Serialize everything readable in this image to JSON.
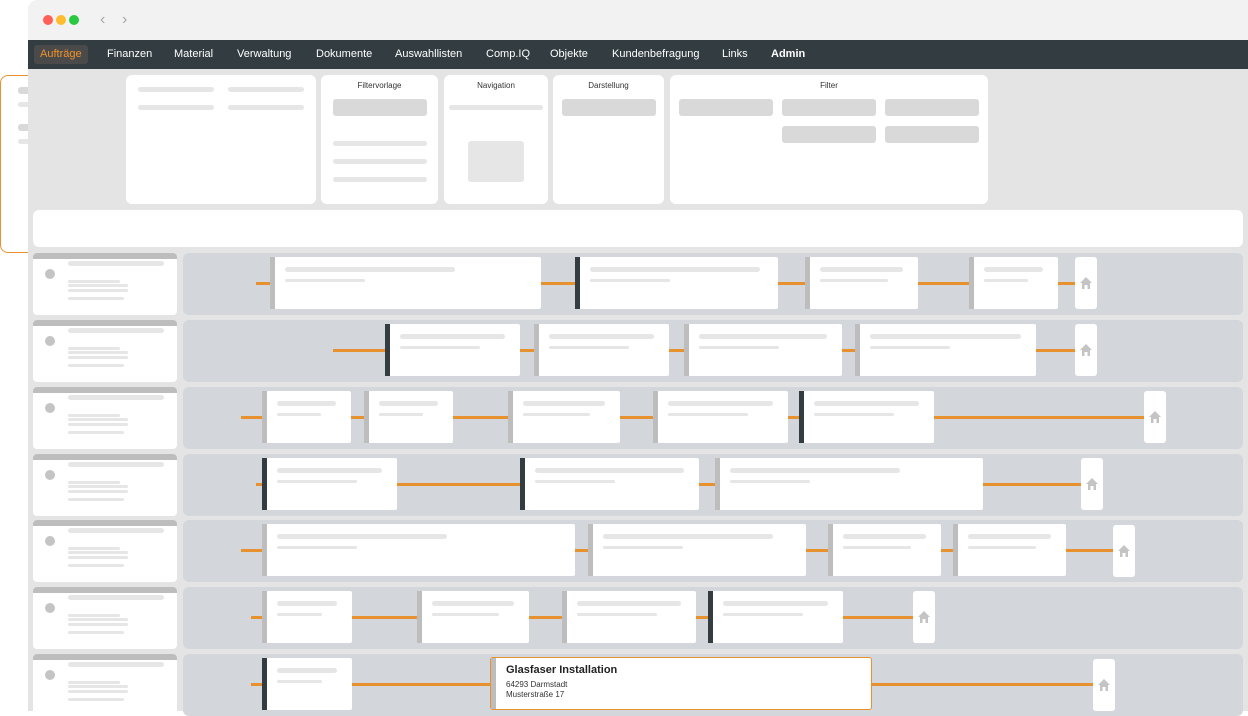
{
  "window": {
    "back_label": "‹",
    "forward_label": "›"
  },
  "menu": {
    "items": [
      {
        "label": "Aufträge"
      },
      {
        "label": "Finanzen"
      },
      {
        "label": "Material"
      },
      {
        "label": "Verwaltung"
      },
      {
        "label": "Dokumente"
      },
      {
        "label": "Auswahllisten"
      },
      {
        "label": "Comp.IQ"
      },
      {
        "label": "Objekte"
      },
      {
        "label": "Kundenbefragung"
      },
      {
        "label": "Links"
      },
      {
        "label": "Admin"
      }
    ],
    "active_index": 0
  },
  "panels": {
    "filtervorlage_title": "Filtervorlage",
    "navigation_title": "Navigation",
    "darstellung_title": "Darstellung",
    "filter_title": "Filter"
  },
  "popup": {
    "title": "Glasfaser Installation",
    "line1": "64293 Darmstadt",
    "line2": "Musterstraße 17"
  },
  "colors": {
    "accent": "#e8912f",
    "menubar": "#323c41",
    "job_bar_dark": "#323c41",
    "job_bar_light": "#bdbdbd",
    "band": "#d3d6da"
  },
  "icons": {
    "house": "house-icon",
    "back": "chevron-left-icon",
    "forward": "chevron-right-icon"
  }
}
